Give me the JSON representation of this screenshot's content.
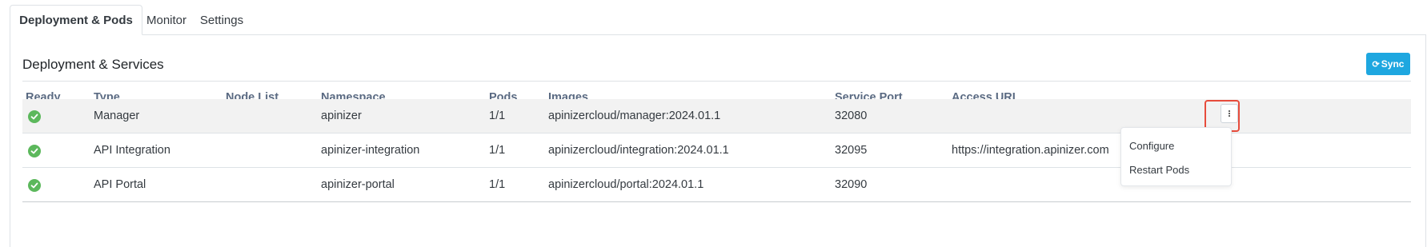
{
  "tabs": [
    {
      "label": "Deployment & Pods",
      "active": true
    },
    {
      "label": "Monitor",
      "active": false
    },
    {
      "label": "Settings",
      "active": false
    }
  ],
  "card": {
    "title": "Deployment & Services",
    "sync_label": "Sync",
    "sync_icon": "refresh-icon",
    "sync_color": "#1ea7e0"
  },
  "table": {
    "headers": [
      "Ready",
      "Type",
      "Node List",
      "Namespace",
      "Pods",
      "Images",
      "Service Port",
      "Access URL"
    ],
    "rows": [
      {
        "ready": "check-circle-icon",
        "type": "Manager",
        "node_list": "",
        "namespace": "apinizer",
        "pods": "1/1",
        "images": "apinizercloud/manager:2024.01.1",
        "service_port": "32080",
        "access_url": ""
      },
      {
        "ready": "check-circle-icon",
        "type": "API Integration",
        "node_list": "",
        "namespace": "apinizer-integration",
        "pods": "1/1",
        "images": "apinizercloud/integration:2024.01.1",
        "service_port": "32095",
        "access_url": "https://integration.apinizer.com"
      },
      {
        "ready": "check-circle-icon",
        "type": "API Portal",
        "node_list": "",
        "namespace": "apinizer-portal",
        "pods": "1/1",
        "images": "apinizercloud/portal:2024.01.1",
        "service_port": "32090",
        "access_url": ""
      }
    ]
  },
  "row_menu": {
    "items": [
      "Configure",
      "Restart Pods"
    ]
  },
  "colors": {
    "ready_ok": "#5cb85c",
    "highlight": "#e74c3c"
  }
}
